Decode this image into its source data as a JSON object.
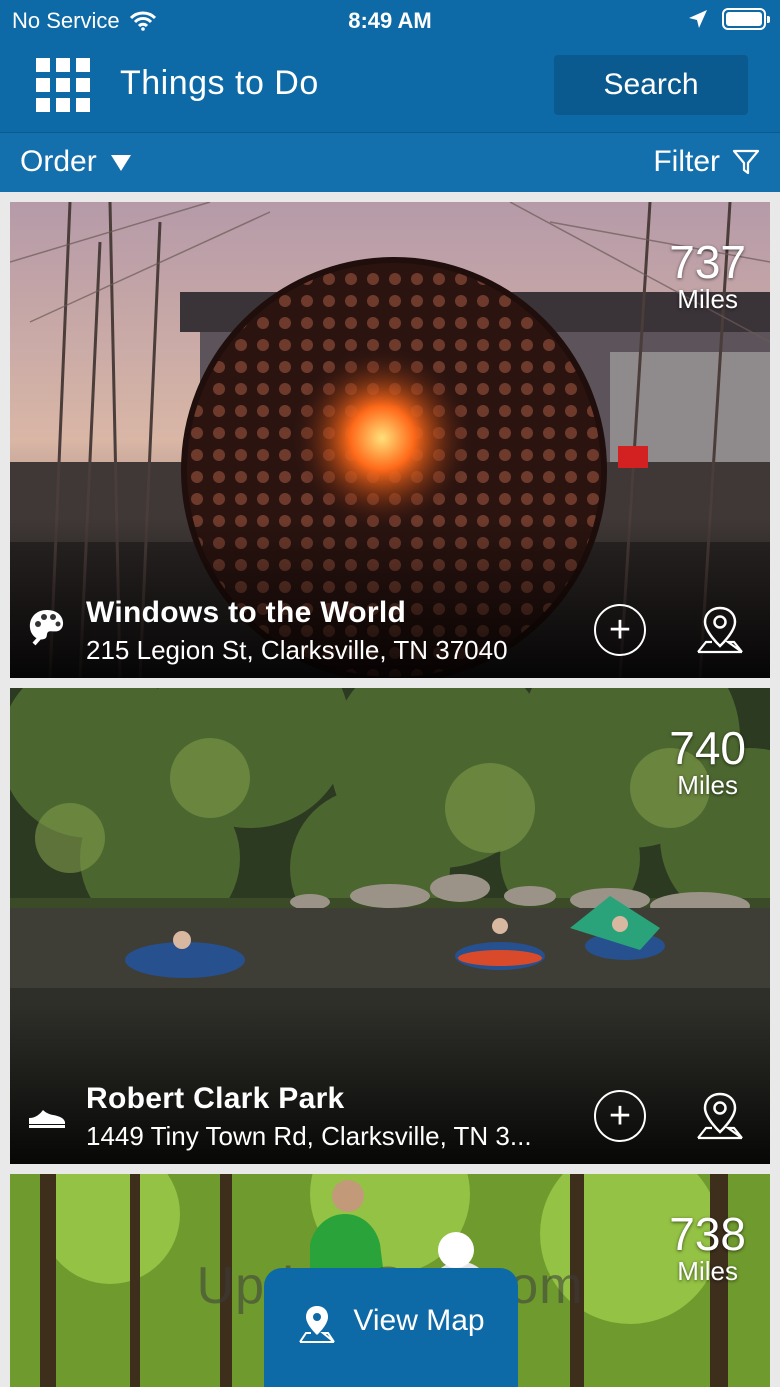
{
  "status_bar": {
    "carrier": "No Service",
    "time": "8:49 AM"
  },
  "header": {
    "title": "Things to Do",
    "search_label": "Search"
  },
  "toolbar": {
    "order_label": "Order",
    "filter_label": "Filter"
  },
  "cards": [
    {
      "name": "Windows to the World",
      "address": "215 Legion St, Clarksville, TN 37040",
      "distance": "737",
      "distance_unit": "Miles",
      "category_icon": "palette-icon"
    },
    {
      "name": "Robert Clark Park",
      "address": "1449 Tiny Town Rd, Clarksville, TN 3...",
      "distance": "740",
      "distance_unit": "Miles",
      "category_icon": "shoe-icon"
    },
    {
      "name": "",
      "address": "",
      "distance": "738",
      "distance_unit": "Miles",
      "category_icon": ""
    }
  ],
  "view_map_label": "View Map",
  "watermark": "UpdateStar.com",
  "colors": {
    "primary": "#0d6aa6",
    "toolbar": "#1470ad"
  }
}
